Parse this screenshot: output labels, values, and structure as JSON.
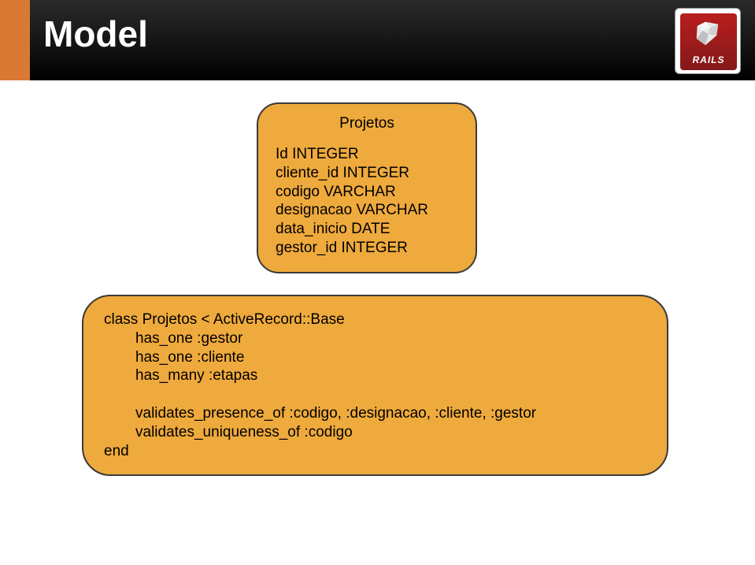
{
  "header": {
    "title": "Model"
  },
  "logo": {
    "text": "RAILS"
  },
  "table_box": {
    "title": "Projetos",
    "fields": [
      "Id INTEGER",
      "cliente_id INTEGER",
      "codigo VARCHAR",
      "designacao VARCHAR",
      "data_inicio DATE",
      "gestor_id INTEGER"
    ]
  },
  "code_box": {
    "lines": [
      {
        "text": "class Projetos < ActiveRecord::Base",
        "indent": 0
      },
      {
        "text": "has_one :gestor",
        "indent": 1
      },
      {
        "text": "has_one :cliente",
        "indent": 1
      },
      {
        "text": "has_many :etapas",
        "indent": 1
      },
      {
        "text": "",
        "indent": 1,
        "blank": true
      },
      {
        "text": "validates_presence_of :codigo, :designacao, :cliente, :gestor",
        "indent": 1
      },
      {
        "text": "validates_uniqueness_of :codigo",
        "indent": 1
      },
      {
        "text": "end",
        "indent": 0
      }
    ]
  }
}
